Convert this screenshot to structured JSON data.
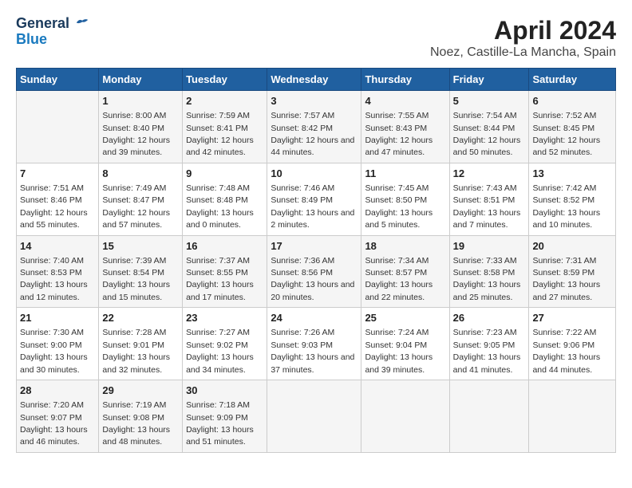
{
  "logo": {
    "general": "General",
    "blue": "Blue"
  },
  "title": "April 2024",
  "subtitle": "Noez, Castille-La Mancha, Spain",
  "days_of_week": [
    "Sunday",
    "Monday",
    "Tuesday",
    "Wednesday",
    "Thursday",
    "Friday",
    "Saturday"
  ],
  "weeks": [
    [
      {
        "num": "",
        "sunrise": "",
        "sunset": "",
        "daylight": ""
      },
      {
        "num": "1",
        "sunrise": "Sunrise: 8:00 AM",
        "sunset": "Sunset: 8:40 PM",
        "daylight": "Daylight: 12 hours and 39 minutes."
      },
      {
        "num": "2",
        "sunrise": "Sunrise: 7:59 AM",
        "sunset": "Sunset: 8:41 PM",
        "daylight": "Daylight: 12 hours and 42 minutes."
      },
      {
        "num": "3",
        "sunrise": "Sunrise: 7:57 AM",
        "sunset": "Sunset: 8:42 PM",
        "daylight": "Daylight: 12 hours and 44 minutes."
      },
      {
        "num": "4",
        "sunrise": "Sunrise: 7:55 AM",
        "sunset": "Sunset: 8:43 PM",
        "daylight": "Daylight: 12 hours and 47 minutes."
      },
      {
        "num": "5",
        "sunrise": "Sunrise: 7:54 AM",
        "sunset": "Sunset: 8:44 PM",
        "daylight": "Daylight: 12 hours and 50 minutes."
      },
      {
        "num": "6",
        "sunrise": "Sunrise: 7:52 AM",
        "sunset": "Sunset: 8:45 PM",
        "daylight": "Daylight: 12 hours and 52 minutes."
      }
    ],
    [
      {
        "num": "7",
        "sunrise": "Sunrise: 7:51 AM",
        "sunset": "Sunset: 8:46 PM",
        "daylight": "Daylight: 12 hours and 55 minutes."
      },
      {
        "num": "8",
        "sunrise": "Sunrise: 7:49 AM",
        "sunset": "Sunset: 8:47 PM",
        "daylight": "Daylight: 12 hours and 57 minutes."
      },
      {
        "num": "9",
        "sunrise": "Sunrise: 7:48 AM",
        "sunset": "Sunset: 8:48 PM",
        "daylight": "Daylight: 13 hours and 0 minutes."
      },
      {
        "num": "10",
        "sunrise": "Sunrise: 7:46 AM",
        "sunset": "Sunset: 8:49 PM",
        "daylight": "Daylight: 13 hours and 2 minutes."
      },
      {
        "num": "11",
        "sunrise": "Sunrise: 7:45 AM",
        "sunset": "Sunset: 8:50 PM",
        "daylight": "Daylight: 13 hours and 5 minutes."
      },
      {
        "num": "12",
        "sunrise": "Sunrise: 7:43 AM",
        "sunset": "Sunset: 8:51 PM",
        "daylight": "Daylight: 13 hours and 7 minutes."
      },
      {
        "num": "13",
        "sunrise": "Sunrise: 7:42 AM",
        "sunset": "Sunset: 8:52 PM",
        "daylight": "Daylight: 13 hours and 10 minutes."
      }
    ],
    [
      {
        "num": "14",
        "sunrise": "Sunrise: 7:40 AM",
        "sunset": "Sunset: 8:53 PM",
        "daylight": "Daylight: 13 hours and 12 minutes."
      },
      {
        "num": "15",
        "sunrise": "Sunrise: 7:39 AM",
        "sunset": "Sunset: 8:54 PM",
        "daylight": "Daylight: 13 hours and 15 minutes."
      },
      {
        "num": "16",
        "sunrise": "Sunrise: 7:37 AM",
        "sunset": "Sunset: 8:55 PM",
        "daylight": "Daylight: 13 hours and 17 minutes."
      },
      {
        "num": "17",
        "sunrise": "Sunrise: 7:36 AM",
        "sunset": "Sunset: 8:56 PM",
        "daylight": "Daylight: 13 hours and 20 minutes."
      },
      {
        "num": "18",
        "sunrise": "Sunrise: 7:34 AM",
        "sunset": "Sunset: 8:57 PM",
        "daylight": "Daylight: 13 hours and 22 minutes."
      },
      {
        "num": "19",
        "sunrise": "Sunrise: 7:33 AM",
        "sunset": "Sunset: 8:58 PM",
        "daylight": "Daylight: 13 hours and 25 minutes."
      },
      {
        "num": "20",
        "sunrise": "Sunrise: 7:31 AM",
        "sunset": "Sunset: 8:59 PM",
        "daylight": "Daylight: 13 hours and 27 minutes."
      }
    ],
    [
      {
        "num": "21",
        "sunrise": "Sunrise: 7:30 AM",
        "sunset": "Sunset: 9:00 PM",
        "daylight": "Daylight: 13 hours and 30 minutes."
      },
      {
        "num": "22",
        "sunrise": "Sunrise: 7:28 AM",
        "sunset": "Sunset: 9:01 PM",
        "daylight": "Daylight: 13 hours and 32 minutes."
      },
      {
        "num": "23",
        "sunrise": "Sunrise: 7:27 AM",
        "sunset": "Sunset: 9:02 PM",
        "daylight": "Daylight: 13 hours and 34 minutes."
      },
      {
        "num": "24",
        "sunrise": "Sunrise: 7:26 AM",
        "sunset": "Sunset: 9:03 PM",
        "daylight": "Daylight: 13 hours and 37 minutes."
      },
      {
        "num": "25",
        "sunrise": "Sunrise: 7:24 AM",
        "sunset": "Sunset: 9:04 PM",
        "daylight": "Daylight: 13 hours and 39 minutes."
      },
      {
        "num": "26",
        "sunrise": "Sunrise: 7:23 AM",
        "sunset": "Sunset: 9:05 PM",
        "daylight": "Daylight: 13 hours and 41 minutes."
      },
      {
        "num": "27",
        "sunrise": "Sunrise: 7:22 AM",
        "sunset": "Sunset: 9:06 PM",
        "daylight": "Daylight: 13 hours and 44 minutes."
      }
    ],
    [
      {
        "num": "28",
        "sunrise": "Sunrise: 7:20 AM",
        "sunset": "Sunset: 9:07 PM",
        "daylight": "Daylight: 13 hours and 46 minutes."
      },
      {
        "num": "29",
        "sunrise": "Sunrise: 7:19 AM",
        "sunset": "Sunset: 9:08 PM",
        "daylight": "Daylight: 13 hours and 48 minutes."
      },
      {
        "num": "30",
        "sunrise": "Sunrise: 7:18 AM",
        "sunset": "Sunset: 9:09 PM",
        "daylight": "Daylight: 13 hours and 51 minutes."
      },
      {
        "num": "",
        "sunrise": "",
        "sunset": "",
        "daylight": ""
      },
      {
        "num": "",
        "sunrise": "",
        "sunset": "",
        "daylight": ""
      },
      {
        "num": "",
        "sunrise": "",
        "sunset": "",
        "daylight": ""
      },
      {
        "num": "",
        "sunrise": "",
        "sunset": "",
        "daylight": ""
      }
    ]
  ]
}
